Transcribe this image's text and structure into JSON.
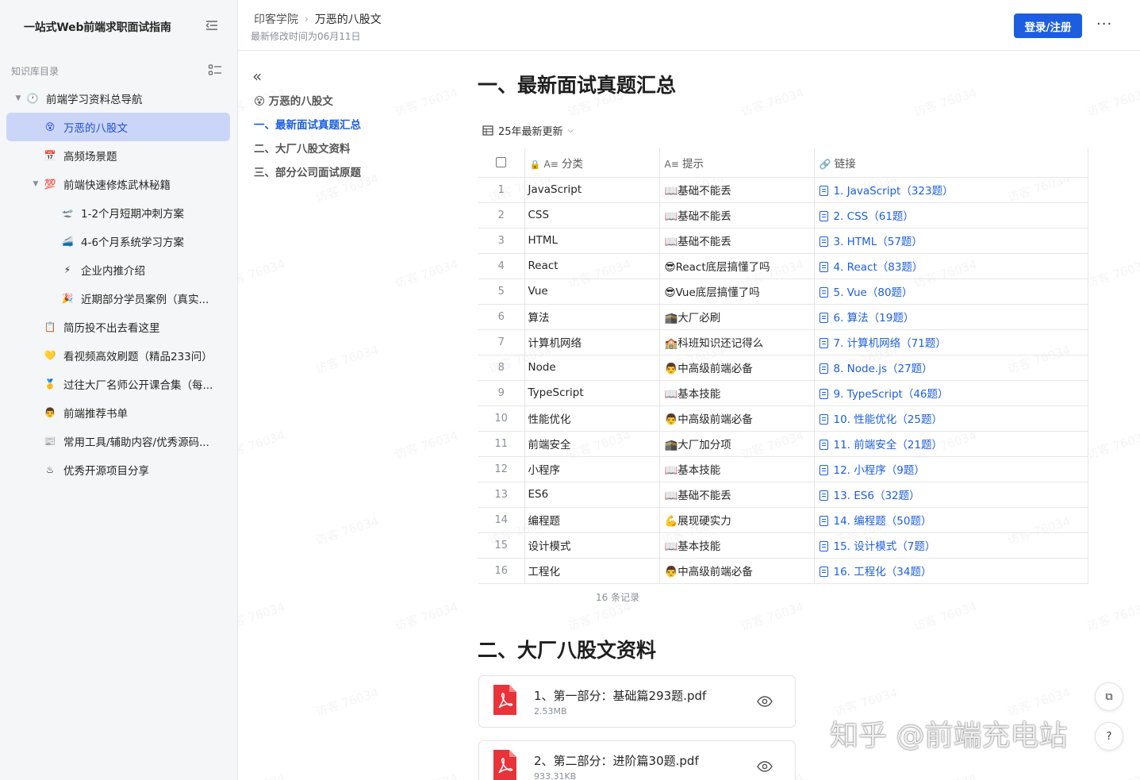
{
  "sidebar": {
    "title": "一站式Web前端求职面试指南",
    "kb_label": "知识库目录",
    "items": [
      {
        "label": "前端学习资料总导航",
        "icon": "🕐",
        "caret": "▼",
        "indent": 0
      },
      {
        "label": "万恶的八股文",
        "icon": "😵",
        "caret": "",
        "indent": 1,
        "active": true
      },
      {
        "label": "高频场景题",
        "icon": "📅",
        "caret": "",
        "indent": 1
      },
      {
        "label": "前端快速修炼武林秘籍",
        "icon": "💯",
        "caret": "▼",
        "indent": 1
      },
      {
        "label": "1-2个月短期冲刺方案",
        "icon": "🛫",
        "caret": "",
        "indent": 2
      },
      {
        "label": "4-6个月系统学习方案",
        "icon": "🚄",
        "caret": "",
        "indent": 2
      },
      {
        "label": "企业内推介绍",
        "icon": "⚡",
        "caret": "",
        "indent": 2
      },
      {
        "label": "近期部分学员案例（真实...",
        "icon": "🎉",
        "caret": "",
        "indent": 2
      },
      {
        "label": "简历投不出去看这里",
        "icon": "📋",
        "caret": "",
        "indent": 1
      },
      {
        "label": "看视频高效刷题（精品233问）",
        "icon": "💛",
        "caret": "",
        "indent": 1
      },
      {
        "label": "过往大厂名师公开课合集（每...",
        "icon": "🥇",
        "caret": "",
        "indent": 1
      },
      {
        "label": "前端推荐书单",
        "icon": "👨",
        "caret": "",
        "indent": 1
      },
      {
        "label": "常用工具/辅助内容/优秀源码...",
        "icon": "📰",
        "caret": "",
        "indent": 1
      },
      {
        "label": "优秀开源项目分享",
        "icon": "♨",
        "caret": "",
        "indent": 1
      }
    ]
  },
  "header": {
    "breadcrumb_root": "印客学院",
    "breadcrumb_current": "万恶的八股文",
    "modified": "最新修改时间为06月11日",
    "login_label": "登录/注册",
    "more_label": "···"
  },
  "outline": {
    "items": [
      {
        "label": "😵 万恶的八股文",
        "current": false
      },
      {
        "label": "一、最新面试真题汇总",
        "current": true
      },
      {
        "label": "二、大厂八股文资料",
        "current": false
      },
      {
        "label": "三、部分公司面试原题",
        "current": false
      }
    ]
  },
  "main": {
    "section1_title": "一、最新面试真题汇总",
    "view_label": "25年最新更新",
    "table": {
      "headers": {
        "category": "分类",
        "hint": "提示",
        "link": "链接"
      },
      "rows": [
        {
          "idx": "1",
          "category": "JavaScript",
          "hint": "📖基础不能丢",
          "link": "1. JavaScript（323题）"
        },
        {
          "idx": "2",
          "category": "CSS",
          "hint": "📖基础不能丢",
          "link": "2. CSS（61题）"
        },
        {
          "idx": "3",
          "category": "HTML",
          "hint": "📖基础不能丢",
          "link": "3. HTML（57题）"
        },
        {
          "idx": "4",
          "category": "React",
          "hint": "😎React底层搞懂了吗",
          "link": "4. React（83题）"
        },
        {
          "idx": "5",
          "category": "Vue",
          "hint": "😎Vue底层搞懂了吗",
          "link": "5. Vue（80题）"
        },
        {
          "idx": "6",
          "category": "算法",
          "hint": "🕋大厂必刷",
          "link": "6. 算法（19题）"
        },
        {
          "idx": "7",
          "category": "计算机网络",
          "hint": "🏫科班知识还记得么",
          "link": "7. 计算机网络（71题）"
        },
        {
          "idx": "8",
          "category": "Node",
          "hint": "👨中高级前端必备",
          "link": "8. Node.js（27题）"
        },
        {
          "idx": "9",
          "category": "TypeScript",
          "hint": "📖基本技能",
          "link": "9. TypeScript（46题）"
        },
        {
          "idx": "10",
          "category": "性能优化",
          "hint": "👨中高级前端必备",
          "link": "10. 性能优化（25题）"
        },
        {
          "idx": "11",
          "category": "前端安全",
          "hint": "🕋大厂加分项",
          "link": "11. 前端安全（21题）"
        },
        {
          "idx": "12",
          "category": "小程序",
          "hint": "📖基本技能",
          "link": "12. 小程序（9题）"
        },
        {
          "idx": "13",
          "category": "ES6",
          "hint": "📖基础不能丢",
          "link": "13. ES6（32题）"
        },
        {
          "idx": "14",
          "category": "编程题",
          "hint": "💪展现硬实力",
          "link": "14. 编程题（50题）"
        },
        {
          "idx": "15",
          "category": "设计模式",
          "hint": "📖基本技能",
          "link": "15. 设计模式（7题）"
        },
        {
          "idx": "16",
          "category": "工程化",
          "hint": "👨中高级前端必备",
          "link": "16. 工程化（34题）"
        }
      ]
    },
    "records": "16 条记录",
    "section2_title": "二、大厂八股文资料",
    "files": [
      {
        "name": "1、第一部分：基础篇293题.pdf",
        "size": "2.53MB"
      },
      {
        "name": "2、第二部分：进阶篇30题.pdf",
        "size": "933.31KB"
      }
    ]
  },
  "watermark_text": "访客 76034",
  "overlay_text": "知乎 @前端充电站",
  "colors": {
    "accent": "#1d5ee0",
    "active_bg": "#cbd5f7",
    "pdf_red": "#e8333a"
  }
}
